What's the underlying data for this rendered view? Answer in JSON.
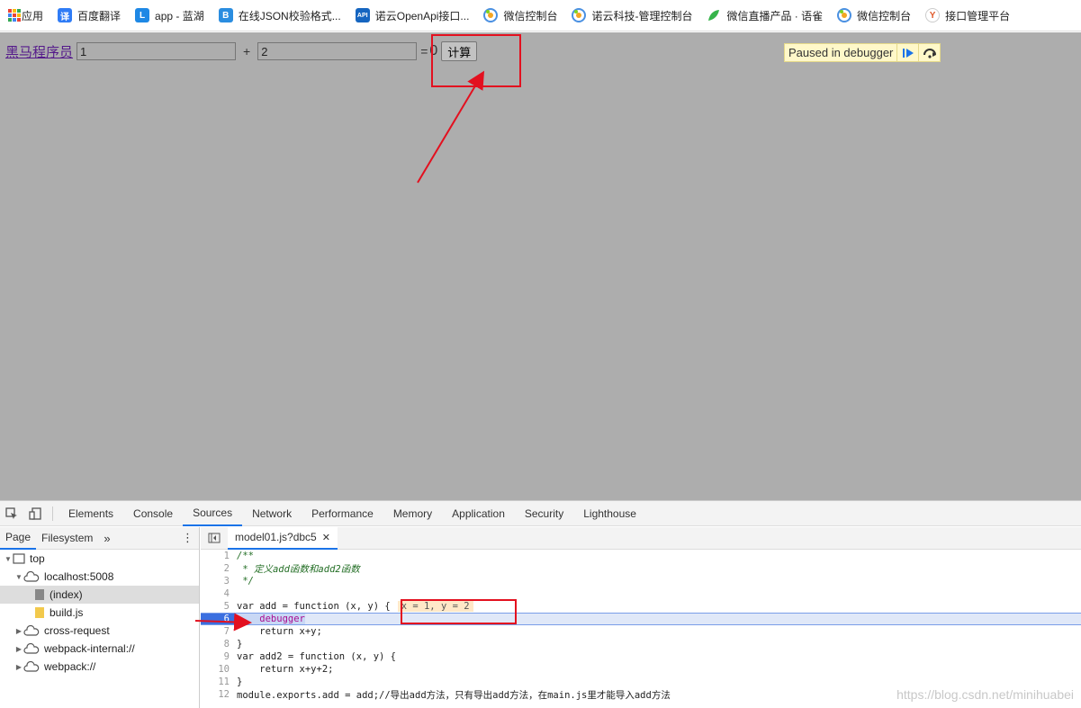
{
  "bookmarks": [
    {
      "label": "应用",
      "icon": "apps-grid-icon",
      "color": "#1a73e8"
    },
    {
      "label": "百度翻译",
      "icon": "translate-icon",
      "glyph": "译",
      "color": "#2f7cf6"
    },
    {
      "label": "app - 蓝湖",
      "icon": "lanhu-icon",
      "glyph": "L",
      "color": "#1e88e5"
    },
    {
      "label": "在线JSON校验格式...",
      "icon": "bejson-icon",
      "glyph": "B",
      "color": "#2a8de0"
    },
    {
      "label": "诺云OpenApi接口...",
      "icon": "api-icon",
      "glyph": "API",
      "color": "#1565c0"
    },
    {
      "label": "微信控制台",
      "icon": "wechat-cloud-icon",
      "glyph": "",
      "color": "#4caf50"
    },
    {
      "label": "诺云科技-管理控制台",
      "icon": "wechat-cloud-icon",
      "glyph": "",
      "color": "#4caf50"
    },
    {
      "label": "微信直播产品 · 语雀",
      "icon": "yuque-icon",
      "glyph": "",
      "color": "#36b44a"
    },
    {
      "label": "微信控制台",
      "icon": "wechat-cloud-icon",
      "glyph": "",
      "color": "#4caf50"
    },
    {
      "label": "接口管理平台",
      "icon": "yapi-icon",
      "glyph": "Y",
      "color": "#e05a2b"
    }
  ],
  "page": {
    "link": "黑马程序员",
    "input1": "1",
    "plus": "+",
    "input2": "2",
    "equals": "=",
    "result": "0",
    "calc_button": "计算"
  },
  "debugger_bar": {
    "text": "Paused in debugger",
    "resume_icon": "resume-icon",
    "step_over_icon": "step-over-icon"
  },
  "devtools": {
    "tabs": [
      "Elements",
      "Console",
      "Sources",
      "Network",
      "Performance",
      "Memory",
      "Application",
      "Security",
      "Lighthouse"
    ],
    "active_tab": "Sources",
    "nav_tabs": [
      "Page",
      "Filesystem"
    ],
    "tree": [
      {
        "label": "top",
        "level": 0,
        "expanded": true,
        "icon": "frame-icon"
      },
      {
        "label": "localhost:5008",
        "level": 1,
        "expanded": true,
        "icon": "cloud-icon"
      },
      {
        "label": "(index)",
        "level": 2,
        "icon": "file-icon",
        "selected": true
      },
      {
        "label": "build.js",
        "level": 2,
        "icon": "js-file-icon"
      },
      {
        "label": "cross-request",
        "level": 1,
        "expanded": false,
        "icon": "cloud-icon"
      },
      {
        "label": "webpack-internal://",
        "level": 1,
        "expanded": false,
        "icon": "cloud-icon"
      },
      {
        "label": "webpack://",
        "level": 1,
        "expanded": false,
        "icon": "cloud-icon"
      }
    ],
    "file_tab": "model01.js?dbc5",
    "code_lines": [
      {
        "n": "1",
        "text": "/**",
        "cls": "cm"
      },
      {
        "n": "2",
        "text": " * 定义add函数和add2函数",
        "cls": "cm"
      },
      {
        "n": "3",
        "text": " */",
        "cls": "cm"
      },
      {
        "n": "4",
        "text": "",
        "cls": ""
      },
      {
        "n": "5",
        "text": "var add = function (x, y) {",
        "cls": "",
        "inline": "x = 1, y = 2"
      },
      {
        "n": "6",
        "text": "    debugger",
        "cls": "kw",
        "current": true
      },
      {
        "n": "7",
        "text": "    return x+y;",
        "cls": ""
      },
      {
        "n": "8",
        "text": "}",
        "cls": ""
      },
      {
        "n": "9",
        "text": "var add2 = function (x, y) {",
        "cls": ""
      },
      {
        "n": "10",
        "text": "    return x+y+2;",
        "cls": ""
      },
      {
        "n": "11",
        "text": "}",
        "cls": ""
      },
      {
        "n": "12",
        "text": "module.exports.add = add;//导出add方法，只有导出add方法，在main.js里才能导入add方法",
        "cls": ""
      }
    ]
  },
  "watermark": "https://blog.csdn.net/minihuabei"
}
